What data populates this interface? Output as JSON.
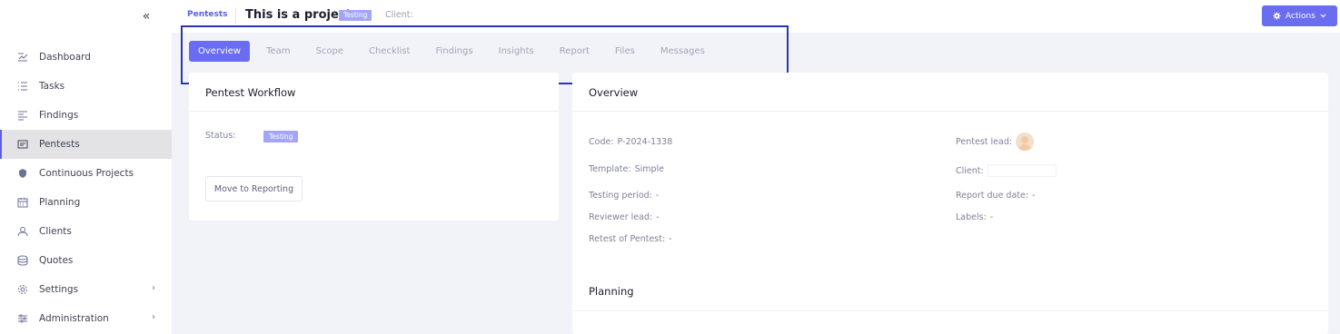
{
  "sidebar": {
    "collapse_icon": "double-chevron-left-icon",
    "items": [
      {
        "label": "Dashboard",
        "icon": "dashboard-icon"
      },
      {
        "label": "Tasks",
        "icon": "tasks-icon"
      },
      {
        "label": "Findings",
        "icon": "findings-icon"
      },
      {
        "label": "Pentests",
        "icon": "pentests-icon",
        "active": true
      },
      {
        "label": "Continuous Projects",
        "icon": "shield-icon"
      },
      {
        "label": "Planning",
        "icon": "calendar-icon"
      },
      {
        "label": "Clients",
        "icon": "clients-icon"
      },
      {
        "label": "Quotes",
        "icon": "quotes-icon"
      },
      {
        "label": "Settings",
        "icon": "gear-icon",
        "has_children": true
      },
      {
        "label": "Administration",
        "icon": "sliders-icon",
        "has_children": true
      }
    ],
    "chevron": "›"
  },
  "header": {
    "breadcrumb": "Pentests",
    "title": "This is a project",
    "status": "Testing",
    "client_label": "Client:",
    "actions_label": "Actions"
  },
  "tabs": [
    "Overview",
    "Team",
    "Scope",
    "Checklist",
    "Findings",
    "Insights",
    "Report",
    "Files",
    "Messages"
  ],
  "workflow": {
    "title": "Pentest Workflow",
    "status_label": "Status:",
    "status_value": "Testing",
    "move_button": "Move to Reporting"
  },
  "overview": {
    "title": "Overview",
    "code_label": "Code:",
    "code_value": "P-2024-1338",
    "template_label": "Template:",
    "template_value": "Simple",
    "testing_period_label": "Testing period:",
    "testing_period_value": "-",
    "reviewer_lead_label": "Reviewer lead:",
    "reviewer_lead_value": "-",
    "retest_label": "Retest of Pentest:",
    "retest_value": "-",
    "pentest_lead_label": "Pentest lead:",
    "client_label": "Client:",
    "report_due_label": "Report due date:",
    "report_due_value": "-",
    "labels_label": "Labels:",
    "labels_value": "-"
  },
  "planning": {
    "title": "Planning"
  },
  "colors": {
    "accent": "#6a6df0",
    "status_pill": "#a5a5f5",
    "highlight": "#2a36b1"
  }
}
